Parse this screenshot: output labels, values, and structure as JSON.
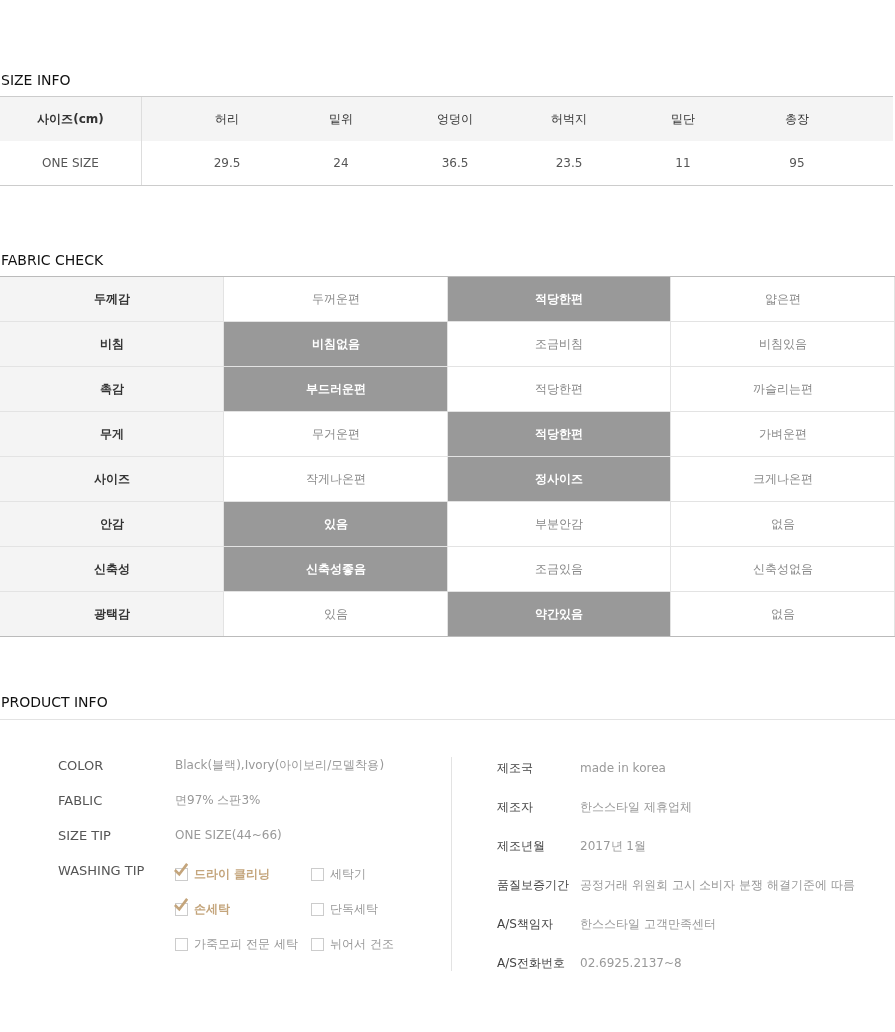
{
  "size_info": {
    "title": "SIZE INFO",
    "columns": [
      "사이즈(cm)",
      "허리",
      "밑위",
      "엉덩이",
      "허벅지",
      "밑단",
      "총장"
    ],
    "rows": [
      [
        "ONE SIZE",
        "29.5",
        "24",
        "36.5",
        "23.5",
        "11",
        "95"
      ]
    ]
  },
  "fabric_check": {
    "title": "FABRIC CHECK",
    "rows": [
      {
        "label": "두께감",
        "options": [
          {
            "text": "두꺼운편",
            "selected": false
          },
          {
            "text": "적당한편",
            "selected": true
          },
          {
            "text": "얇은편",
            "selected": false
          }
        ]
      },
      {
        "label": "비침",
        "options": [
          {
            "text": "비침없음",
            "selected": true
          },
          {
            "text": "조금비침",
            "selected": false
          },
          {
            "text": "비침있음",
            "selected": false
          }
        ]
      },
      {
        "label": "촉감",
        "options": [
          {
            "text": "부드러운편",
            "selected": true
          },
          {
            "text": "적당한편",
            "selected": false
          },
          {
            "text": "까슬리는편",
            "selected": false
          }
        ]
      },
      {
        "label": "무게",
        "options": [
          {
            "text": "무거운편",
            "selected": false
          },
          {
            "text": "적당한편",
            "selected": true
          },
          {
            "text": "가벼운편",
            "selected": false
          }
        ]
      },
      {
        "label": "사이즈",
        "options": [
          {
            "text": "작게나온편",
            "selected": false
          },
          {
            "text": "정사이즈",
            "selected": true
          },
          {
            "text": "크게나온편",
            "selected": false
          }
        ]
      },
      {
        "label": "안감",
        "options": [
          {
            "text": "있음",
            "selected": true
          },
          {
            "text": "부분안감",
            "selected": false
          },
          {
            "text": "없음",
            "selected": false
          }
        ]
      },
      {
        "label": "신축성",
        "options": [
          {
            "text": "신축성좋음",
            "selected": true
          },
          {
            "text": "조금있음",
            "selected": false
          },
          {
            "text": "신축성없음",
            "selected": false
          }
        ]
      },
      {
        "label": "광택감",
        "options": [
          {
            "text": "있음",
            "selected": false
          },
          {
            "text": "약간있음",
            "selected": true
          },
          {
            "text": "없음",
            "selected": false
          }
        ]
      }
    ]
  },
  "product_info": {
    "title": "PRODUCT INFO",
    "left": [
      {
        "label": "COLOR",
        "value": "Black(블랙),Ivory(아이보리/모델착용)"
      },
      {
        "label": "FABLIC",
        "value": "면97% 스판3%"
      },
      {
        "label": "SIZE TIP",
        "value": "ONE SIZE(44~66)"
      }
    ],
    "washing_tip": {
      "label": "WASHING TIP",
      "options": [
        {
          "text": "드라이 클리닝",
          "checked": true
        },
        {
          "text": "세탁기",
          "checked": false
        },
        {
          "text": "손세탁",
          "checked": true
        },
        {
          "text": "단독세탁",
          "checked": false
        },
        {
          "text": "가죽모피 전문 세탁",
          "checked": false
        },
        {
          "text": "뉘어서 건조",
          "checked": false
        }
      ]
    },
    "right": [
      {
        "label": "제조국",
        "value": "made in korea"
      },
      {
        "label": "제조자",
        "value": "한스스타일 제휴업체"
      },
      {
        "label": "제조년월",
        "value": "2017년 1월"
      },
      {
        "label": "품질보증기간",
        "value": "공정거래 위원회 고시 소비자 분쟁 해결기준에 따름"
      },
      {
        "label": "A/S책임자",
        "value": "한스스타일 고객만족센터"
      },
      {
        "label": "A/S전화번호",
        "value": "02.6925.2137~8"
      }
    ]
  }
}
